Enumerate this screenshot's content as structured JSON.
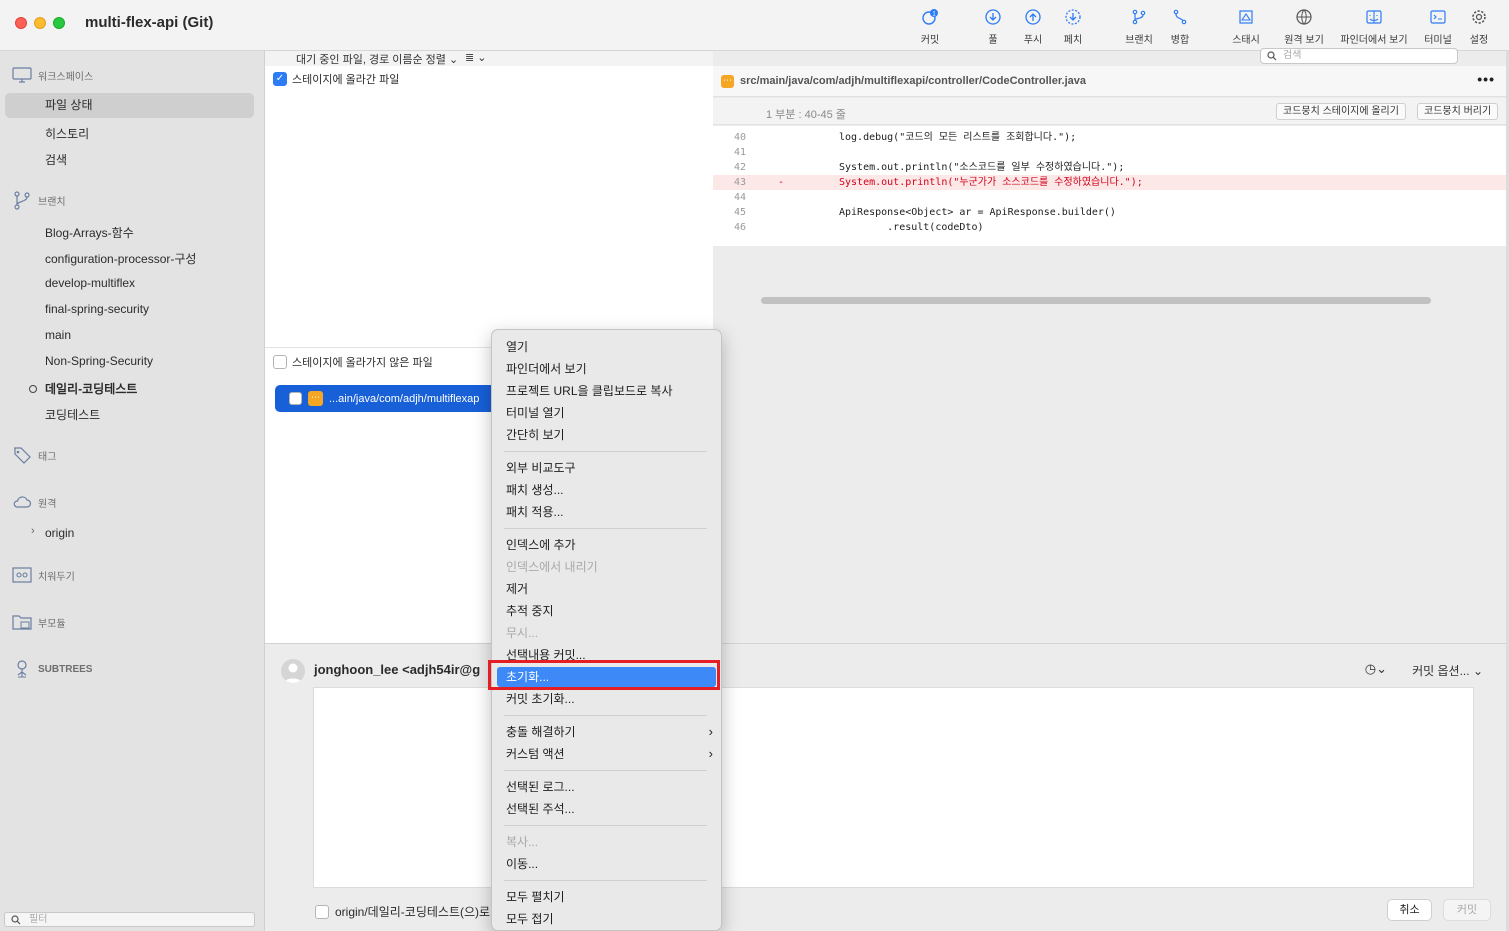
{
  "window": {
    "title": "multi-flex-api (Git)"
  },
  "toolbar": {
    "commit": "커밋",
    "commit_badge": "1",
    "pull": "풀",
    "push": "푸시",
    "fetch": "페치",
    "branch": "브랜치",
    "merge": "병합",
    "stash": "스태시",
    "remote_view": "원격 보기",
    "finder_view": "파인더에서 보기",
    "terminal": "터미널",
    "settings": "설정",
    "search_placeholder": "검색"
  },
  "sidebar": {
    "workspace": "워크스페이스",
    "file_status": "파일 상태",
    "history": "히스토리",
    "search": "검색",
    "branches": "브랜치",
    "branch_items": [
      "Blog-Arrays-함수",
      "configuration-processor-구성",
      "develop-multiflex",
      "final-spring-security",
      "main",
      "Non-Spring-Security",
      "데일리-코딩테스트",
      "코딩테스트"
    ],
    "current_branch": "데일리-코딩테스트",
    "tags": "태그",
    "remotes": "원격",
    "remote_items": [
      "origin"
    ],
    "stashes": "치워두기",
    "submodules": "부모듈",
    "subtrees": "SUBTREES",
    "filter_placeholder": "필터"
  },
  "filelist": {
    "sort_label": "대기 중인 파일, 경로 이름순 정렬",
    "list_icon": "≣",
    "staged_header": "스테이지에 올라간 파일",
    "unstaged_header": "스테이지에 올라가지 않은 파일",
    "unstaged_file": "...ain/java/com/adjh/multiflexap"
  },
  "diff": {
    "path": "src/main/java/com/adjh/multiflexapi/controller/CodeController.java",
    "hunk_label": "1 부분 : 40-45 줄",
    "stage_hunk": "코드뭉치 스테이지에 올리기",
    "discard_hunk": "코드뭉치 버리기",
    "lines": [
      {
        "no": "40",
        "text": "log.debug(\"코드의 모든 리스트를 조회합니다.\");",
        "type": "ctx"
      },
      {
        "no": "41",
        "text": "",
        "type": "ctx"
      },
      {
        "no": "42",
        "text": "System.out.println(\"소스코드를 일부 수정하였습니다.\");",
        "type": "ctx"
      },
      {
        "no": "43",
        "text": "System.out.println(\"누군가가 소스코드를 수정하였습니다.\");",
        "type": "del",
        "mark": "-"
      },
      {
        "no": "44",
        "text": "",
        "type": "ctx"
      },
      {
        "no": "45",
        "text": "ApiResponse<Object> ar = ApiResponse.builder()",
        "type": "ctx"
      },
      {
        "no": "46",
        "text": "        .result(codeDto)",
        "type": "ctx"
      }
    ]
  },
  "commit": {
    "author": "jonghoon_lee <adjh54ir@g",
    "options": "커밋 옵션...",
    "push_label": "origin/데일리-코딩테스트(으)로",
    "cancel": "취소",
    "commit": "커밋"
  },
  "context_menu": {
    "items": [
      {
        "label": "열기"
      },
      {
        "label": "파인더에서 보기"
      },
      {
        "label": "프로젝트 URL을 클립보드로 복사"
      },
      {
        "label": "터미널 열기"
      },
      {
        "label": "간단히 보기"
      },
      {
        "label": "외부 비교도구"
      },
      {
        "label": "패치 생성..."
      },
      {
        "label": "패치 적용..."
      },
      {
        "label": "인덱스에 추가"
      },
      {
        "label": "인덱스에서 내리기",
        "disabled": true
      },
      {
        "label": "제거"
      },
      {
        "label": "추적 중지"
      },
      {
        "label": "무시...",
        "disabled": true
      },
      {
        "label": "선택내용 커밋..."
      },
      {
        "label": "초기화...",
        "highlighted": true
      },
      {
        "label": "커밋 초기화..."
      },
      {
        "label": "충돌 해결하기"
      },
      {
        "label": "커스텀 액션"
      },
      {
        "label": "선택된 로그..."
      },
      {
        "label": "선택된 주석..."
      },
      {
        "label": "복사...",
        "disabled": true
      },
      {
        "label": "이동..."
      },
      {
        "label": "모두 펼치기"
      },
      {
        "label": "모두 접기"
      }
    ]
  },
  "colors": {
    "accent": "#2d7cf6",
    "menu_highlight": "#3c89f7",
    "annotation": "#e51e25",
    "deleted": "#d0021b"
  }
}
